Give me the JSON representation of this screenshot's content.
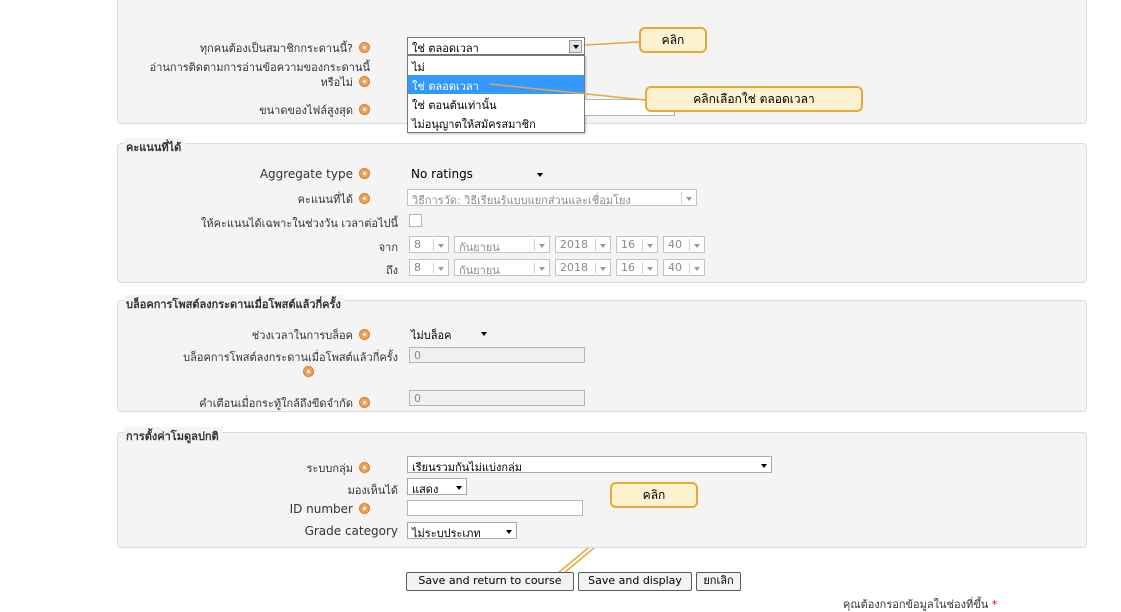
{
  "colors": {
    "accent_callout_border": "#e7a83a",
    "callout_bg": "#fdf2d0",
    "highlight": "#3399ff",
    "help_icon": "#f2a25a",
    "required_star": "#ee0000"
  },
  "top": {
    "subscription_label": "ทุกคนต้องเป็นสมาชิกกระดานนี้?",
    "subscription_value": "ใช่ ตลอดเวลา",
    "tracking_label_line1": "อ่านการติดตามการอ่านข้อความของกระดานนี้",
    "tracking_label_line2": "หรือไม่",
    "maxsize_label": "ขนาดของไฟล์สูงสุด",
    "dropdown_options": [
      "ไม่",
      "ใช่ ตลอดเวลา",
      "ใช่ ตอนต้นเท่านั้น",
      "ไม่อนุญาตให้สมัครสมาชิก"
    ]
  },
  "callouts": {
    "click1": "คลิก",
    "choose": "คลิกเลือกใช่ ตลอดเวลา",
    "click2": "คลิก"
  },
  "ratings": {
    "legend": "คะแนนที่ได้",
    "aggregate_label": "Aggregate type",
    "aggregate_value": "No ratings",
    "scale_label": "คะแนนที่ได้",
    "scale_value": "วิธีการวัด: วิธีเรียนรู้แบบแยกส่วนและเชื่อมโยง",
    "restrict_label": "ให้คะแนนได้เฉพาะในช่วงวัน เวลาต่อไปนี้",
    "from_label": "จาก",
    "to_label": "ถึง",
    "from": {
      "day": "8",
      "month": "กันยายน",
      "year": "2018",
      "hour": "16",
      "minute": "40"
    },
    "to": {
      "day": "8",
      "month": "กันยายน",
      "year": "2018",
      "hour": "16",
      "minute": "40"
    }
  },
  "blocking": {
    "legend": "บล็อคการโพสต์ลงกระดานเมื่อโพสต์แล้วกี่ครั้ง",
    "period_label": "ช่วงเวลาในการบล็อค",
    "period_value": "ไม่บล็อค",
    "threshold_label": "บล็อคการโพสต์ลงกระดานเมื่อโพสต์แล้วกี่ครั้ง",
    "threshold_value": "0",
    "warning_label": "คำเตือนเมื่อกระทู้ใกล้ถึงขีดจำกัด",
    "warning_value": "0"
  },
  "common": {
    "legend": "การตั้งค่าโมดูลปกติ",
    "groupmode_label": "ระบบกลุ่ม",
    "groupmode_value": "เรียนรวมกันไม่แบ่งกลุ่ม",
    "visible_label": "มองเห็นได้",
    "visible_value": "แสดง",
    "idnumber_label": "ID number",
    "idnumber_value": "",
    "gradecat_label": "Grade category",
    "gradecat_value": "ไม่ระบุประเภท"
  },
  "buttons": {
    "save_return": "Save and return to course",
    "save_display": "Save and display",
    "cancel": "ยกเลิก"
  },
  "footer": {
    "required_note": "คุณต้องกรอกข้อมูลในช่องที่ขึ้น",
    "star": "*"
  }
}
